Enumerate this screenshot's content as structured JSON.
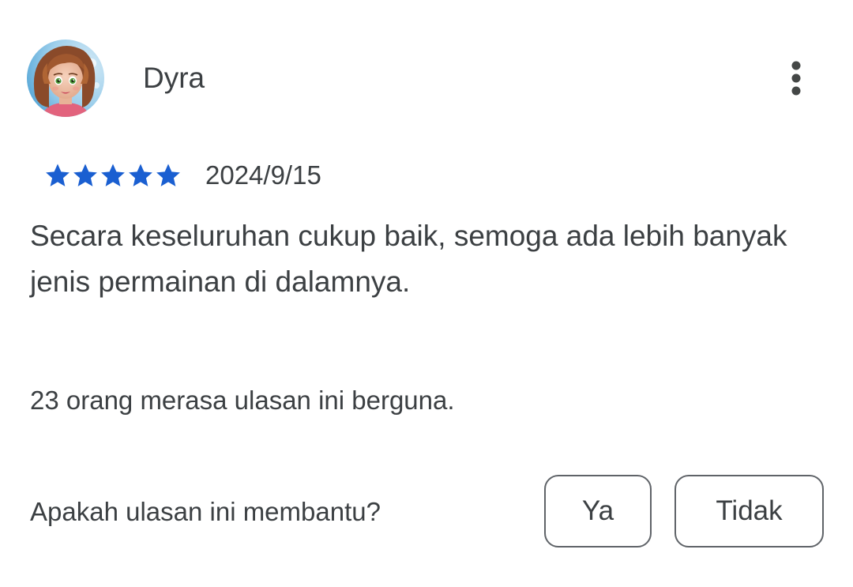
{
  "review": {
    "reviewer_name": "Dyra",
    "avatar_icon": "reviewer-avatar",
    "more_icon": "more-vert-icon",
    "rating": 5,
    "rating_max": 5,
    "star_color": "#1a5fd1",
    "date": "2024/9/15",
    "text": "Secara keseluruhan cukup baik, semoga ada lebih banyak jenis permainan di dalamnya.",
    "helpful_count_text": "23 orang merasa ulasan ini berguna."
  },
  "feedback": {
    "question": "Apakah ulasan ini membantu?",
    "yes_label": "Ya",
    "no_label": "Tidak"
  }
}
